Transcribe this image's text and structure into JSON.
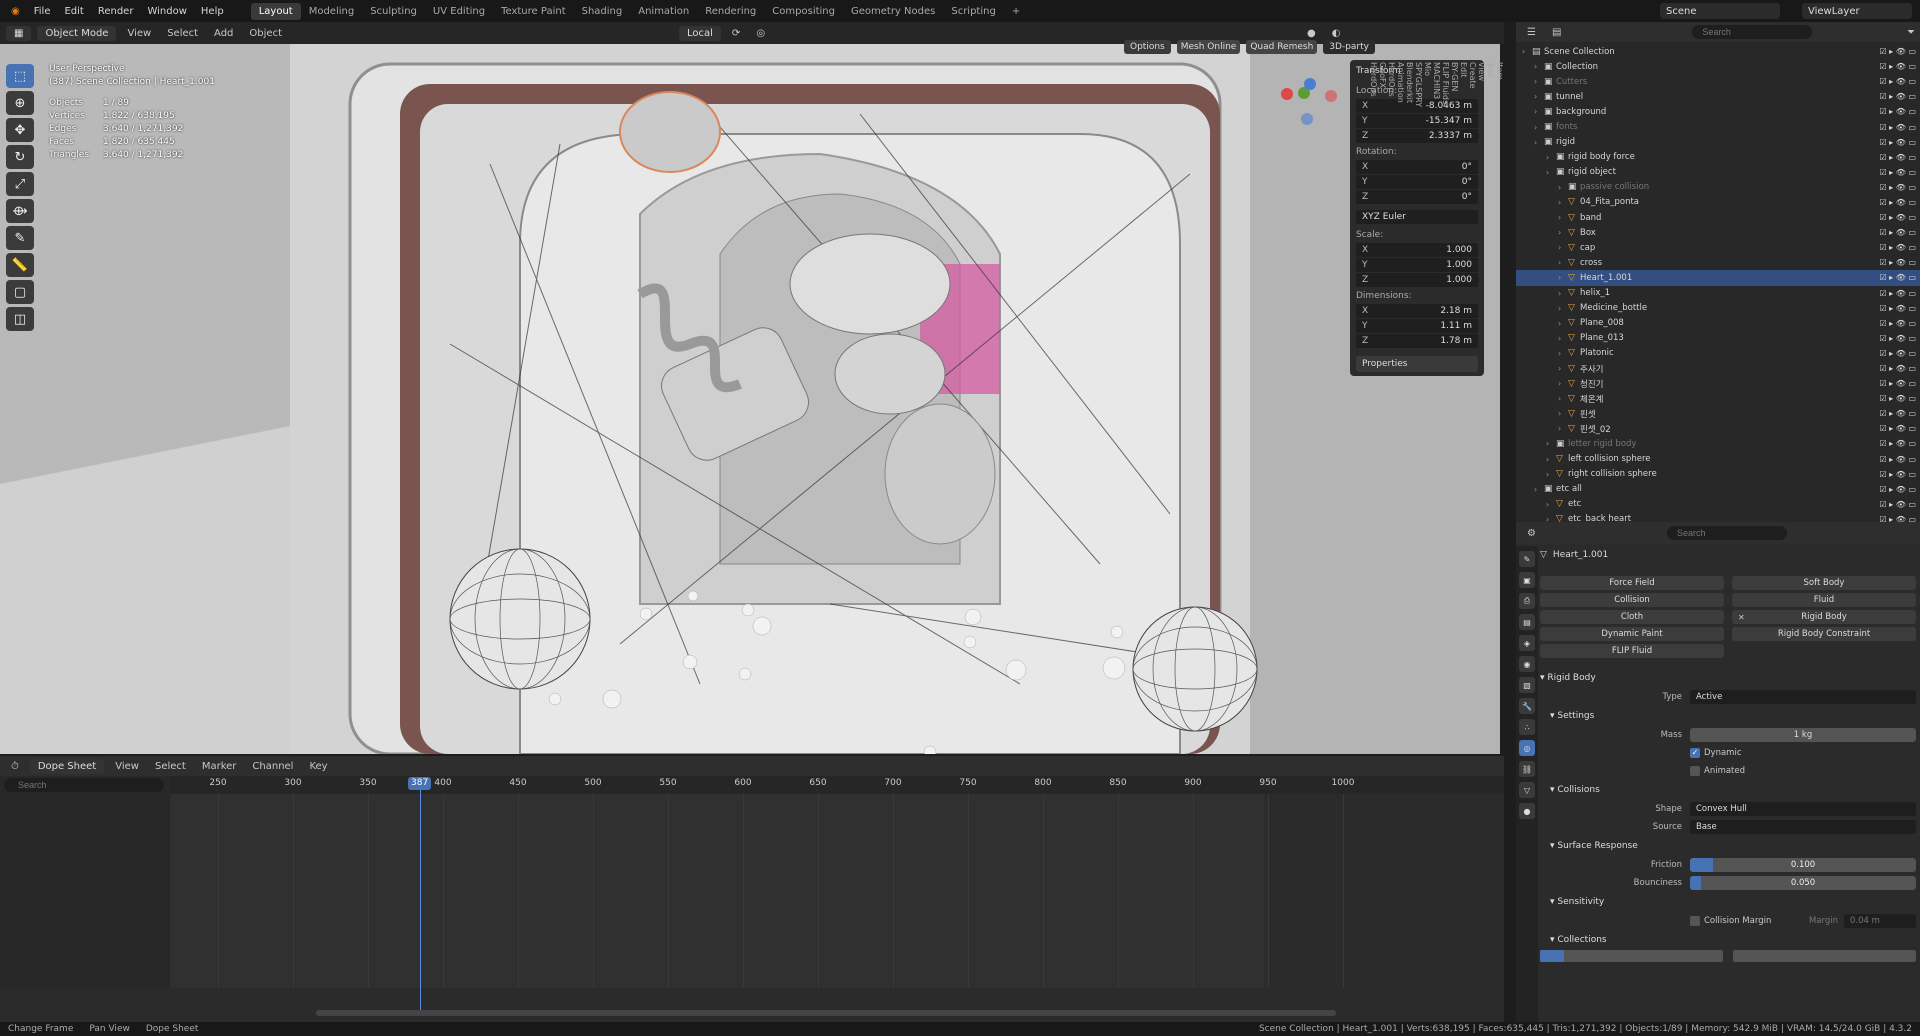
{
  "menu": [
    "File",
    "Edit",
    "Render",
    "Window",
    "Help"
  ],
  "workspaces": [
    "Layout",
    "Modeling",
    "Sculpting",
    "UV Editing",
    "Texture Paint",
    "Shading",
    "Animation",
    "Rendering",
    "Compositing",
    "Geometry Nodes",
    "Scripting"
  ],
  "active_workspace": "Layout",
  "scene_name": "Scene",
  "view_layer": "ViewLayer",
  "viewport_header": {
    "mode": "Object Mode",
    "menus": [
      "View",
      "Select",
      "Add",
      "Object"
    ],
    "orientation": "Local",
    "options": "Options",
    "mesh_online": "Mesh Online",
    "quad_remesh": "Quad Remesh",
    "third_party": "3D-party"
  },
  "viewport_info": {
    "view": "User Perspective",
    "context": "(387) Scene Collection | Heart_1.001",
    "stats": [
      {
        "k": "Objects",
        "v": "1 / 89"
      },
      {
        "k": "Vertices",
        "v": "1,822 / 638,195"
      },
      {
        "k": "Edges",
        "v": "3,640 / 1,271,392"
      },
      {
        "k": "Faces",
        "v": "1,820 / 635,445"
      },
      {
        "k": "Triangles",
        "v": "3,640 / 1,271,392"
      }
    ]
  },
  "transform": {
    "title": "Transform",
    "location_label": "Location:",
    "location": {
      "x": "-8.0463 m",
      "y": "-15.347 m",
      "z": "2.3337 m"
    },
    "rotation_label": "Rotation:",
    "rotation": {
      "x": "0°",
      "y": "0°",
      "z": "0°"
    },
    "euler": "XYZ Euler",
    "scale_label": "Scale:",
    "scale": {
      "x": "1.000",
      "y": "1.000",
      "z": "1.000"
    },
    "dimensions_label": "Dimensions:",
    "dimensions": {
      "x": "2.18 m",
      "y": "1.11 m",
      "z": "1.78 m"
    },
    "properties": "Properties"
  },
  "side_tabs": [
    "Item",
    "Tool",
    "View",
    "Create",
    "Edit",
    "BY-GEN",
    "FLIP Fluids",
    "MACHIN3",
    "Mio",
    "SPYGLSPRY",
    "Blenderkit",
    "Animation",
    "HardOps",
    "GeoFX",
    "HardOps"
  ],
  "dopesheet": {
    "editor": "Dope Sheet",
    "menus": [
      "View",
      "Select",
      "Marker",
      "Channel",
      "Key"
    ],
    "search_placeholder": "Search",
    "ticks": [
      "250",
      "300",
      "350",
      "400",
      "450",
      "500",
      "550",
      "600",
      "650",
      "700",
      "750",
      "800",
      "850",
      "900",
      "950",
      "1000"
    ],
    "current_frame": "387"
  },
  "statusbar": {
    "left": [
      "Change Frame",
      "Pan View",
      "Dope Sheet"
    ],
    "right": "Scene Collection | Heart_1.001 | Verts:638,195 | Faces:635,445 | Tris:1,271,392 | Objects:1/89 | Memory: 542.9 MiB | VRAM: 14.5/24.0 GiB | 4.3.2"
  },
  "outliner": {
    "search_placeholder": "Search",
    "rows": [
      {
        "name": "Scene Collection",
        "indent": 0,
        "icon": "▤",
        "sel": false,
        "dim": false
      },
      {
        "name": "Collection",
        "indent": 1,
        "icon": "▣",
        "sel": false,
        "dim": false
      },
      {
        "name": "Cutters",
        "indent": 1,
        "icon": "▣",
        "sel": false,
        "dim": true
      },
      {
        "name": "tunnel",
        "indent": 1,
        "icon": "▣",
        "sel": false,
        "dim": false
      },
      {
        "name": "background",
        "indent": 1,
        "icon": "▣",
        "sel": false,
        "dim": false
      },
      {
        "name": "fonts",
        "indent": 1,
        "icon": "▣",
        "sel": false,
        "dim": true
      },
      {
        "name": "rigid",
        "indent": 1,
        "icon": "▣",
        "sel": false,
        "dim": false
      },
      {
        "name": "rigid body force",
        "indent": 2,
        "icon": "▣",
        "sel": false,
        "dim": false
      },
      {
        "name": "rigid object",
        "indent": 2,
        "icon": "▣",
        "sel": false,
        "dim": false
      },
      {
        "name": "passive collision",
        "indent": 3,
        "icon": "▣",
        "sel": false,
        "dim": true
      },
      {
        "name": "04_Fita_ponta",
        "indent": 3,
        "icon": "▽",
        "sel": false,
        "dim": false
      },
      {
        "name": "band",
        "indent": 3,
        "icon": "▽",
        "sel": false,
        "dim": false
      },
      {
        "name": "Box",
        "indent": 3,
        "icon": "▽",
        "sel": false,
        "dim": false
      },
      {
        "name": "cap",
        "indent": 3,
        "icon": "▽",
        "sel": false,
        "dim": false
      },
      {
        "name": "cross",
        "indent": 3,
        "icon": "▽",
        "sel": false,
        "dim": false
      },
      {
        "name": "Heart_1.001",
        "indent": 3,
        "icon": "▽",
        "sel": true,
        "dim": false
      },
      {
        "name": "helix_1",
        "indent": 3,
        "icon": "▽",
        "sel": false,
        "dim": false
      },
      {
        "name": "Medicine_bottle",
        "indent": 3,
        "icon": "▽",
        "sel": false,
        "dim": false
      },
      {
        "name": "Plane_008",
        "indent": 3,
        "icon": "▽",
        "sel": false,
        "dim": false
      },
      {
        "name": "Plane_013",
        "indent": 3,
        "icon": "▽",
        "sel": false,
        "dim": false
      },
      {
        "name": "Platonic",
        "indent": 3,
        "icon": "▽",
        "sel": false,
        "dim": false
      },
      {
        "name": "주사기",
        "indent": 3,
        "icon": "▽",
        "sel": false,
        "dim": false
      },
      {
        "name": "청진기",
        "indent": 3,
        "icon": "▽",
        "sel": false,
        "dim": false
      },
      {
        "name": "체온계",
        "indent": 3,
        "icon": "▽",
        "sel": false,
        "dim": false
      },
      {
        "name": "핀셋",
        "indent": 3,
        "icon": "▽",
        "sel": false,
        "dim": false
      },
      {
        "name": "핀셋_02",
        "indent": 3,
        "icon": "▽",
        "sel": false,
        "dim": false
      },
      {
        "name": "letter rigid body",
        "indent": 2,
        "icon": "▣",
        "sel": false,
        "dim": true
      },
      {
        "name": "left collision sphere",
        "indent": 2,
        "icon": "▽",
        "sel": false,
        "dim": false
      },
      {
        "name": "right collision sphere",
        "indent": 2,
        "icon": "▽",
        "sel": false,
        "dim": false
      },
      {
        "name": "etc all",
        "indent": 1,
        "icon": "▣",
        "sel": false,
        "dim": false
      },
      {
        "name": "etc",
        "indent": 2,
        "icon": "▽",
        "sel": false,
        "dim": false
      },
      {
        "name": "etc_back heart",
        "indent": 2,
        "icon": "▽",
        "sel": false,
        "dim": false
      }
    ]
  },
  "properties": {
    "search_placeholder": "Search",
    "object_name": "Heart_1.001",
    "physics_buttons": [
      {
        "label": "Force Field",
        "x": false
      },
      {
        "label": "Soft Body",
        "x": false
      },
      {
        "label": "Collision",
        "x": false
      },
      {
        "label": "Fluid",
        "x": false
      },
      {
        "label": "Cloth",
        "x": false
      },
      {
        "label": "Rigid Body",
        "x": true
      },
      {
        "label": "Dynamic Paint",
        "x": false
      },
      {
        "label": "Rigid Body Constraint",
        "x": false
      },
      {
        "label": "FLIP Fluid",
        "x": false
      }
    ],
    "rigid_body": "Rigid Body",
    "type_label": "Type",
    "type_value": "Active",
    "settings": "Settings",
    "mass_label": "Mass",
    "mass_value": "1 kg",
    "dynamic": "Dynamic",
    "animated": "Animated",
    "collisions": "Collisions",
    "shape_label": "Shape",
    "shape_value": "Convex Hull",
    "source_label": "Source",
    "source_value": "Base",
    "surface_response": "Surface Response",
    "friction_label": "Friction",
    "friction_value": "0.100",
    "friction_fill": 0.1,
    "bounciness_label": "Bounciness",
    "bounciness_value": "0.050",
    "bounciness_fill": 0.05,
    "sensitivity": "Sensitivity",
    "collision_margin": "Collision Margin",
    "margin_label": "Margin",
    "margin_value": "0.04 m",
    "collections": "Collections"
  }
}
